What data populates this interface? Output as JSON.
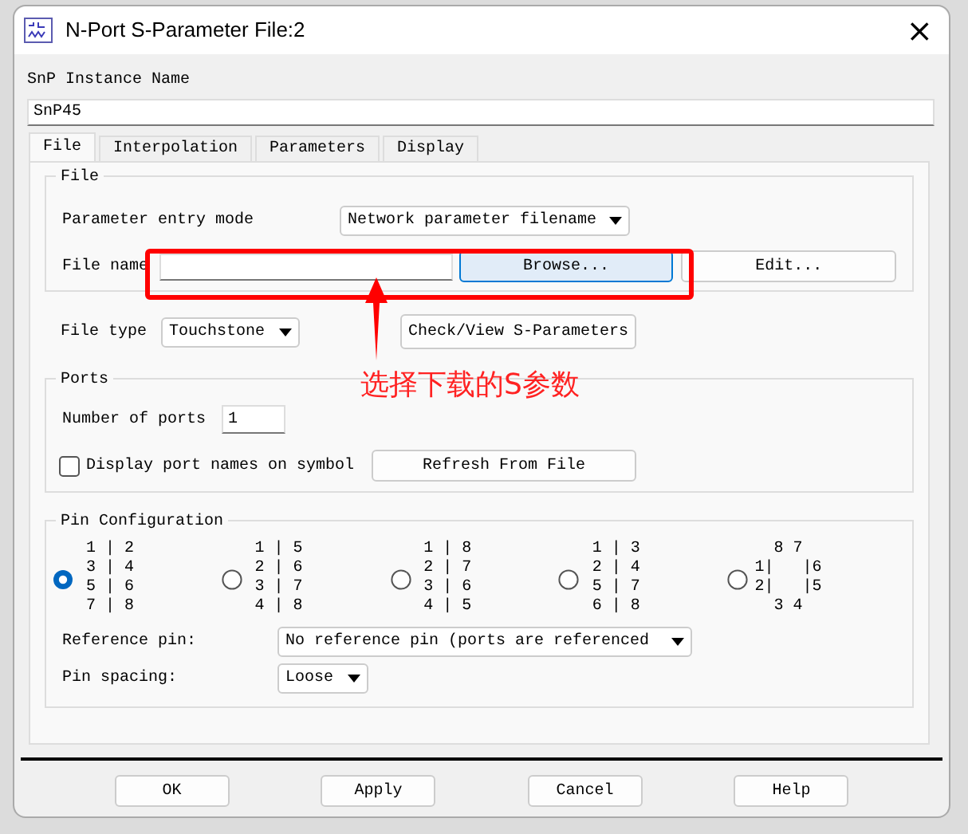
{
  "window": {
    "title": "N-Port S-Parameter File:2",
    "close": "×"
  },
  "instance": {
    "label": "SnP Instance Name",
    "value": "SnP45"
  },
  "tabs": [
    {
      "label": "File",
      "selected": true
    },
    {
      "label": "Interpolation",
      "selected": false
    },
    {
      "label": "Parameters",
      "selected": false
    },
    {
      "label": "Display",
      "selected": false
    }
  ],
  "file_group": {
    "legend": "File",
    "entry_mode_label": "Parameter entry mode",
    "entry_mode_value": "Network parameter filename",
    "file_name_label": "File name",
    "browse_button": "Browse...",
    "edit_button": "Edit..."
  },
  "file_type": {
    "label": "File type",
    "value": "Touchstone",
    "check_button": "Check/View S-Parameters"
  },
  "ports_group": {
    "legend": "Ports",
    "number_label": "Number of ports",
    "number_value": "1",
    "display_names_label": "Display port names on symbol",
    "display_names_checked": false,
    "refresh_button": "Refresh From File"
  },
  "pin_group": {
    "legend": "Pin Configuration",
    "options": [
      {
        "selected": true,
        "lines": [
          "1 | 2",
          "3 | 4",
          "5 | 6",
          "7 | 8"
        ]
      },
      {
        "selected": false,
        "lines": [
          "1 | 5",
          "2 | 6",
          "3 | 7",
          "4 | 8"
        ]
      },
      {
        "selected": false,
        "lines": [
          "1 | 8",
          "2 | 7",
          "3 | 6",
          "4 | 5"
        ]
      },
      {
        "selected": false,
        "lines": [
          "1 | 3",
          "2 | 4",
          "5 | 7",
          "6 | 8"
        ]
      },
      {
        "selected": false,
        "lines": [
          "  8 7",
          "1|   |6",
          "2|   |5",
          "  3 4"
        ]
      }
    ],
    "reference_label": "Reference pin:",
    "reference_value": "No reference pin (ports are referenced",
    "spacing_label": "Pin spacing:",
    "spacing_value": "Loose"
  },
  "buttons": [
    "OK",
    "Apply",
    "Cancel",
    "Help"
  ],
  "annotation": {
    "text": "选择下载的S参数"
  }
}
